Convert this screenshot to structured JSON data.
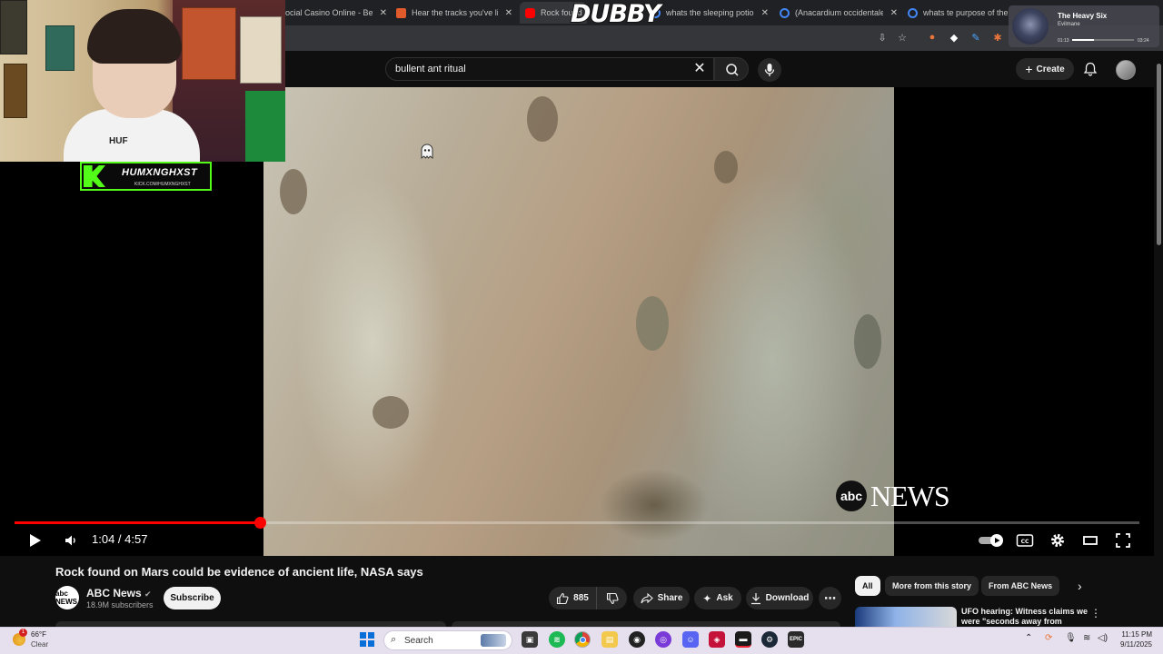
{
  "browser": {
    "tabs": [
      {
        "label": "ocial Casino Online - Be",
        "favicon_color": "#c0392b",
        "active": false
      },
      {
        "label": "Hear the tracks you've lik",
        "favicon_color": "#e05a2b",
        "active": false
      },
      {
        "label": "Rock found",
        "favicon_color": "#ff0000",
        "active": true
      },
      {
        "label": "whats the sleeping potion",
        "favicon_color": "#4285f4",
        "active": false
      },
      {
        "label": "(Anacardium occidentale",
        "favicon_color": "#4285f4",
        "active": false
      },
      {
        "label": "whats te purpose of the b",
        "favicon_color": "#4285f4",
        "active": false
      }
    ],
    "close_glyph": "✕"
  },
  "overlay": {
    "dubby_text": "DUBBY",
    "kick_name": "HUMXNGHXST",
    "kick_url": "KICK.COM/HUMXNGHXST",
    "shirt_text": "HUF"
  },
  "music": {
    "song": "The Heavy Six",
    "artist": "Evilmane",
    "elapsed": "01:13",
    "duration": "03:24",
    "progress": 0.36
  },
  "youtube": {
    "search_value": "bullent ant ritual",
    "create_label": "Create",
    "channel_watermark": "NEWS",
    "abc_mark": "abc",
    "player": {
      "current_time": "1:04 / 4:57",
      "progress": 0.218
    },
    "video": {
      "title": "Rock found on Mars could be evidence of ancient life, NASA says",
      "channel": "ABC News",
      "channel_avatar_text": "abc NEWS",
      "subscribers": "18.9M subscribers",
      "subscribe_label": "Subscribe",
      "likes": "885",
      "share_label": "Share",
      "ask_label": "Ask",
      "download_label": "Download"
    },
    "chips": [
      "All",
      "More from this story",
      "From ABC News"
    ],
    "recommendation": {
      "title": "UFO hearing: Witness claims we were \"seconds away from"
    }
  },
  "taskbar": {
    "temperature": "66°F",
    "weather": "Clear",
    "search_label": "Search",
    "weather_badge": "1",
    "time": "11:15 PM",
    "date": "9/11/2025",
    "epic_label": "EPIC"
  }
}
